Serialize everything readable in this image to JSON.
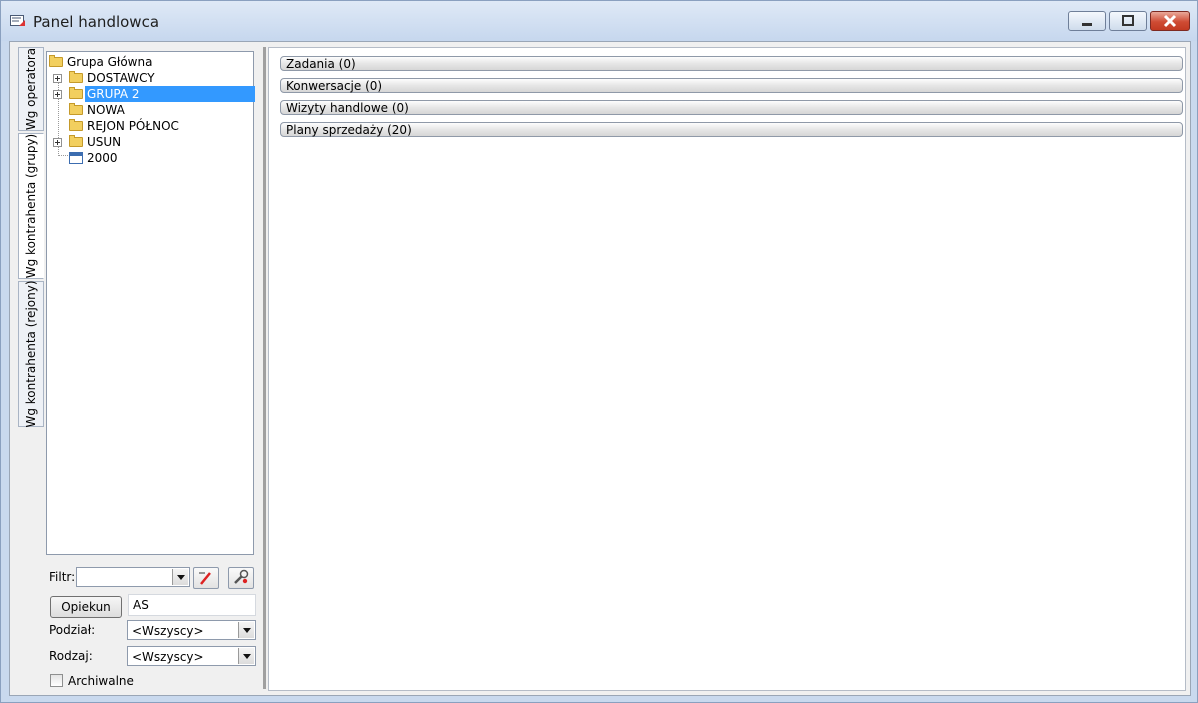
{
  "window": {
    "title": "Panel handlowca"
  },
  "vertical_tabs": [
    {
      "label": "Wg operatora",
      "active": false
    },
    {
      "label": "Wg kontrahenta (grupy)",
      "active": true
    },
    {
      "label": "Wg kontrahenta (rejony)",
      "active": false
    }
  ],
  "tree": {
    "root": "Grupa Główna",
    "items": [
      {
        "label": "DOSTAWCY",
        "expandable": true,
        "selected": false,
        "icon": "folder-icon"
      },
      {
        "label": "GRUPA 2",
        "expandable": true,
        "selected": true,
        "icon": "folder-icon"
      },
      {
        "label": "NOWA",
        "expandable": false,
        "selected": false,
        "icon": "folder-icon"
      },
      {
        "label": "REJON PÓŁNOC",
        "expandable": false,
        "selected": false,
        "icon": "folder-icon"
      },
      {
        "label": "USUN",
        "expandable": true,
        "selected": false,
        "icon": "folder-icon"
      },
      {
        "label": "2000",
        "expandable": false,
        "selected": false,
        "icon": "calendar-icon"
      }
    ]
  },
  "filters": {
    "filter_label": "Filtr:",
    "filter_value": "",
    "opiekun_button": "Opiekun",
    "opiekun_value": "AS",
    "podzial_label": "Podział:",
    "podzial_value": "<Wszyscy>",
    "rodzaj_label": "Rodzaj:",
    "rodzaj_value": "<Wszyscy>",
    "archiwalne_label": "Archiwalne"
  },
  "sections": [
    {
      "label": "Zadania (0)"
    },
    {
      "label": "Konwersacje (0)"
    },
    {
      "label": "Wizyty handlowe (0)"
    },
    {
      "label": "Plany sprzedaży (20)"
    }
  ],
  "colors": {
    "selection": "#3399ff",
    "close_button": "#c9452f",
    "folder": "#f2cf5f"
  }
}
